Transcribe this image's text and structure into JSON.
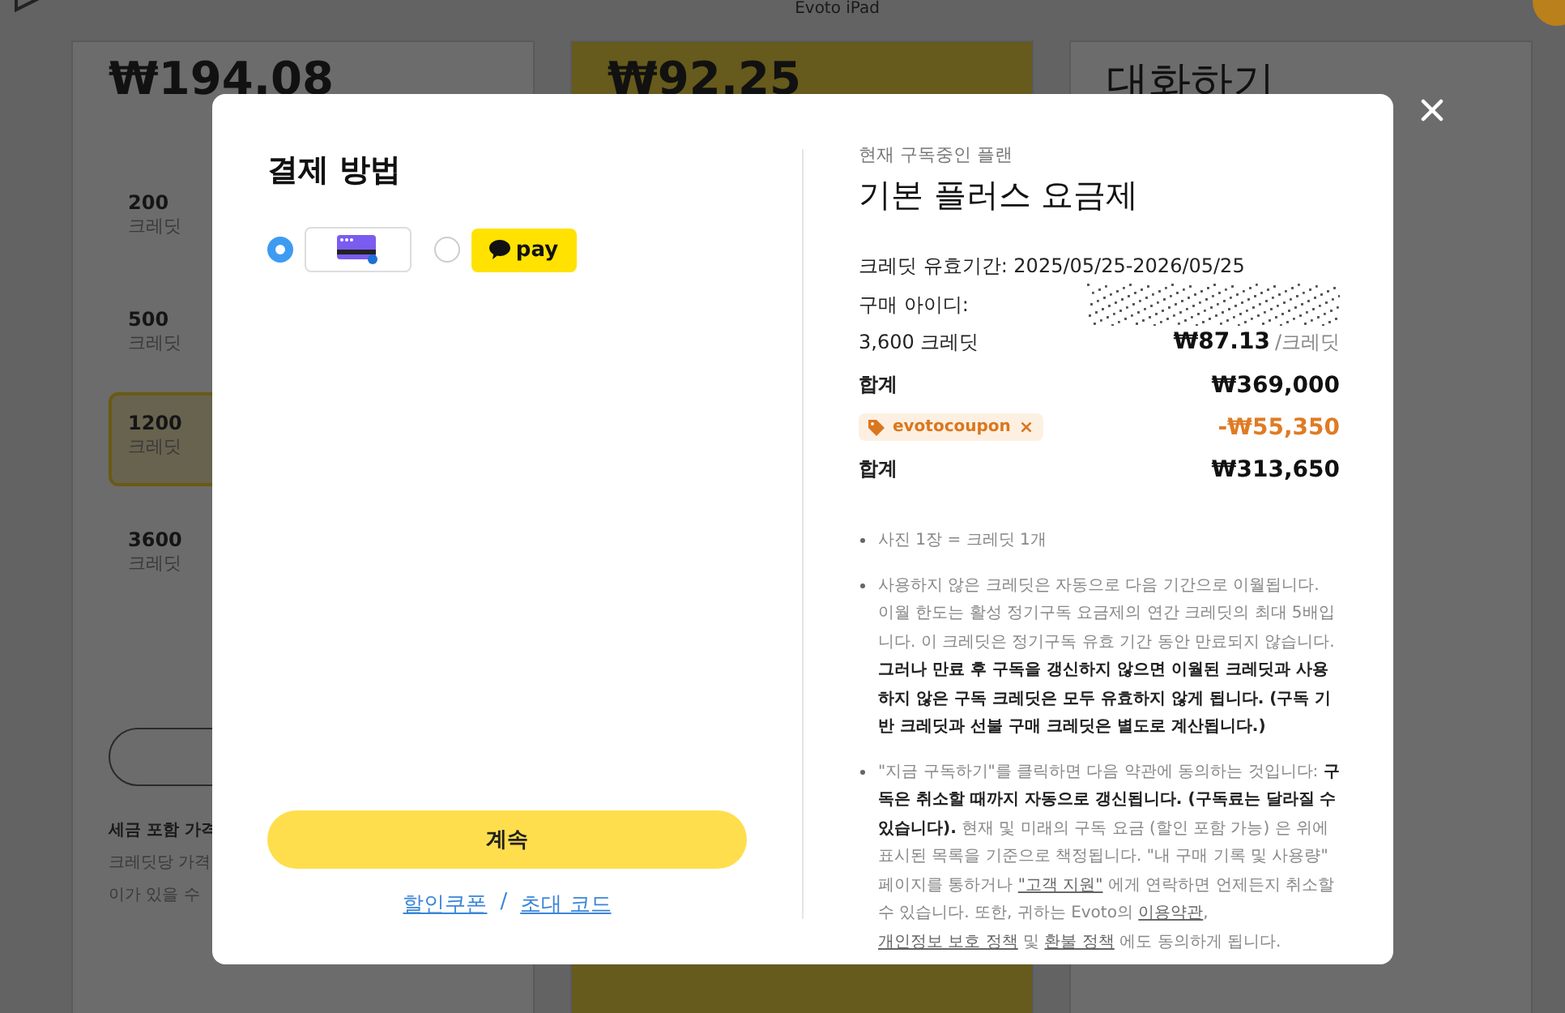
{
  "background": {
    "nav_link": "Evoto iPad",
    "cards": [
      {
        "price": "₩194.08",
        "highlight": false,
        "options": [
          {
            "amount": "200",
            "unit": "크레딧",
            "selected": false
          },
          {
            "amount": "500",
            "unit": "크레딧",
            "selected": false
          },
          {
            "amount": "1200",
            "unit": "크레딧",
            "selected": true
          },
          {
            "amount": "3600",
            "unit": "크레딧",
            "selected": false
          }
        ],
        "footer_title": "세금 포함 가격",
        "footer_lines": [
          "크레딧당 가격",
          "이가 있을 수"
        ]
      },
      {
        "price": "₩92.25",
        "highlight": true
      },
      {
        "heading": "대화하기",
        "highlight": false
      }
    ]
  },
  "dialog": {
    "title": "결제 방법",
    "methods": [
      {
        "kind": "card",
        "selected": true
      },
      {
        "kind": "kakaopay",
        "label": "pay",
        "selected": false
      }
    ],
    "continue_button": "계속",
    "links": [
      "할인쿠폰",
      "초대 코드"
    ],
    "link_separator": "/",
    "plan_caption": "현재 구독중인 플랜",
    "plan_name": "기본 플러스 요금제",
    "validity": "크레딧 유효기간: 2025/05/25-2026/05/25",
    "purchase_id_label": "구매 아이디:",
    "credits": "3,600 크레딧",
    "unit_price": "₩87.13",
    "unit_suffix": "/크레딧",
    "subtotal_label": "합계",
    "subtotal": "₩369,000",
    "coupon": "evotocoupon",
    "coupon_remove": "×",
    "discount": "-₩55,350",
    "total_label": "합계",
    "total": "₩313,650",
    "notes": [
      [
        {
          "kind": "plain",
          "text": "사진 1장 = 크레딧 1개"
        }
      ],
      [
        {
          "kind": "plain",
          "text": "사용하지 않은 크레딧은 자동으로 다음 기간으로 이월됩니다. 이월 한도는 활성 정기구독 요금제의 연간 크레딧의 최대 5배입니다. 이 크레딧은 정기구독 유효 기간 동안 만료되지 않습니다. "
        },
        {
          "kind": "bold",
          "text": "그러나 만료 후 구독을 갱신하지 않으면 이월된 크레딧과 사용하지 않은 구독 크레딧은 모두 유효하지 않게 됩니다. (구독 기반 크레딧과 선불 구매 크레딧은 별도로 계산됩니다.)"
        }
      ],
      [
        {
          "kind": "plain",
          "text": "\"지금 구독하기\"를 클릭하면 다음 약관에 동의하는 것입니다: "
        },
        {
          "kind": "bold",
          "text": "구독은 취소할 때까지 자동으로 갱신됩니다. (구독료는 달라질 수 있습니다)."
        },
        {
          "kind": "plain",
          "text": " 현재 및 미래의 구독 요금 (할인 포함 가능) 은 위에 표시된 목록을 기준으로 책정됩니다. \"내 구매 기록 및 사용량\" 페이지를 통하거나 "
        },
        {
          "kind": "link",
          "text": "\"고객 지원\""
        },
        {
          "kind": "plain",
          "text": " 에게 연락하면 언제든지 취소할 수 있습니다. 또한, 귀하는 Evoto의 "
        },
        {
          "kind": "link",
          "text": "이용약관"
        },
        {
          "kind": "plain",
          "text": ", "
        },
        {
          "kind": "link",
          "text": "개인정보 보호 정책"
        },
        {
          "kind": "plain",
          "text": " 및 "
        },
        {
          "kind": "link",
          "text": "환불 정책"
        },
        {
          "kind": "plain",
          "text": " 에도 동의하게 됩니다."
        }
      ]
    ]
  }
}
